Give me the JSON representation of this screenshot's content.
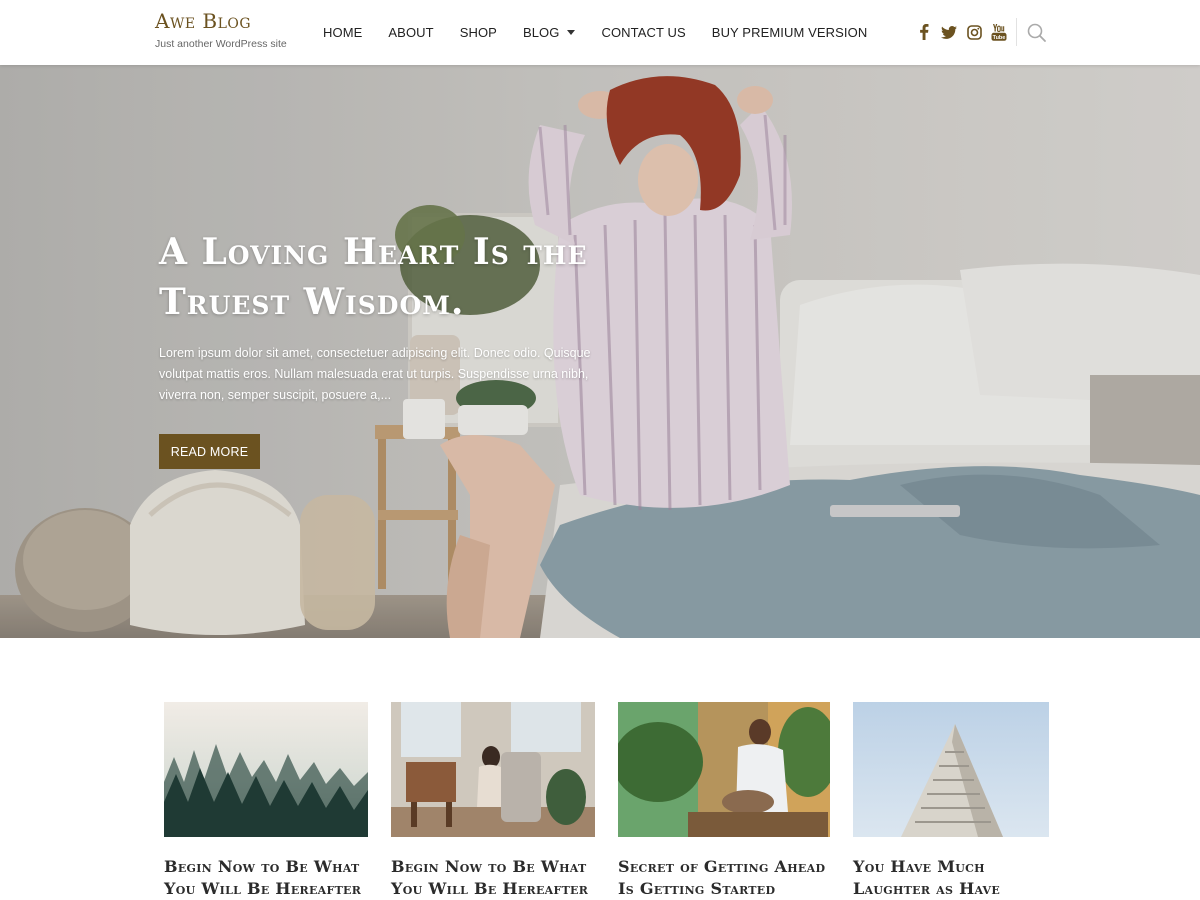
{
  "header": {
    "site_title": "Awe Blog",
    "tagline": "Just another WordPress site",
    "nav": [
      {
        "label": "HOME"
      },
      {
        "label": "ABOUT"
      },
      {
        "label": "SHOP"
      },
      {
        "label": "BLOG",
        "has_dropdown": true
      },
      {
        "label": "CONTACT US"
      },
      {
        "label": "BUY PREMIUM VERSION"
      }
    ],
    "social_icons": [
      "facebook-icon",
      "twitter-icon",
      "instagram-icon",
      "youtube-icon"
    ],
    "search_icon": "search-icon"
  },
  "hero": {
    "title": "A Loving Heart Is the Truest Wisdom.",
    "excerpt": "Lorem ipsum dolor sit amet, consectetuer adipiscing elit. Donec odio. Quisque volutpat mattis eros. Nullam malesuada erat ut turpis. Suspendisse urna nibh, viverra non, semper suscipit, posuere a,...",
    "button_label": "READ MORE"
  },
  "posts": [
    {
      "title": "Begin Now to Be What You Will Be Hereafter"
    },
    {
      "title": "Begin Now to Be What You Will Be Hereafter"
    },
    {
      "title": "Secret of Getting Ahead Is Getting Started"
    },
    {
      "title": "You Have Much Laughter as Have Faith"
    }
  ],
  "colors": {
    "accent": "#6b5220",
    "nav_text": "#222222",
    "hero_text": "#ffffff"
  }
}
